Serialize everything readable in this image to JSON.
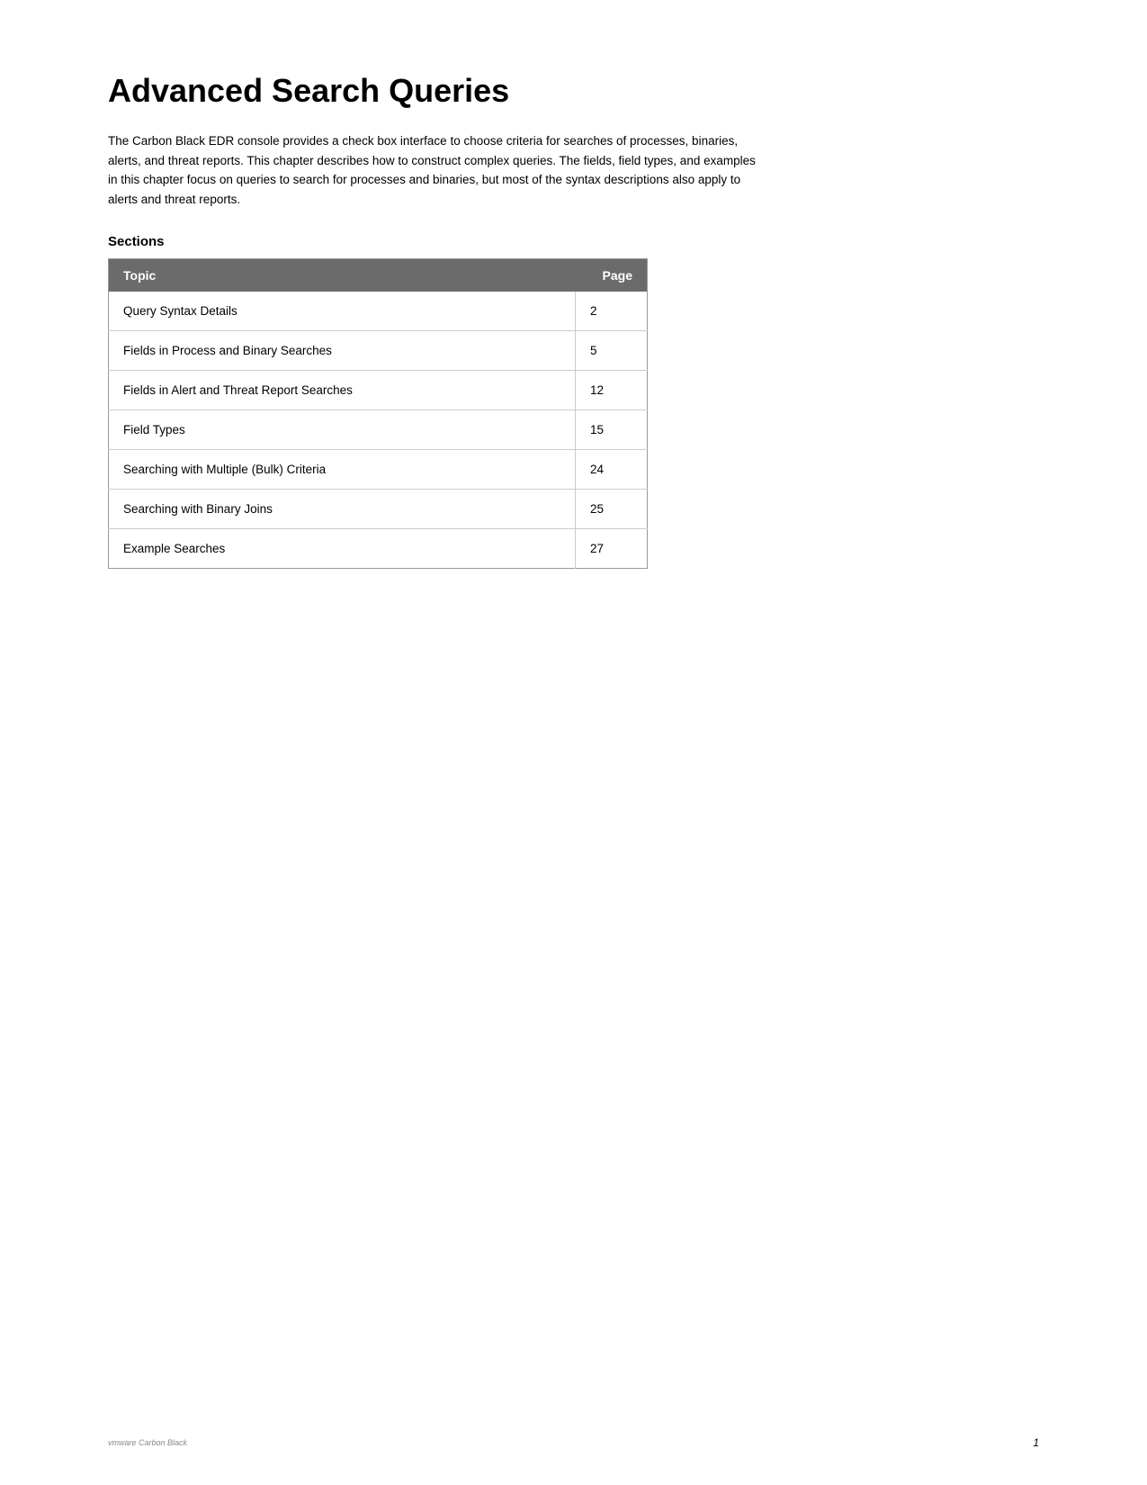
{
  "page": {
    "title": "Advanced Search Queries",
    "intro": "The Carbon Black EDR console provides a check box interface to choose criteria for searches of processes, binaries, alerts, and threat reports. This chapter describes how to construct complex queries. The fields, field types, and examples in this chapter focus on queries to search for processes and binaries, but most of the syntax descriptions also apply to alerts and threat reports.",
    "sections_label": "Sections",
    "table": {
      "headers": {
        "topic": "Topic",
        "page": "Page"
      },
      "rows": [
        {
          "topic": "Query Syntax Details",
          "page": "2"
        },
        {
          "topic": "Fields in Process and Binary Searches",
          "page": "5"
        },
        {
          "topic": "Fields in Alert and Threat Report Searches",
          "page": "12"
        },
        {
          "topic": "Field Types",
          "page": "15"
        },
        {
          "topic": "Searching with Multiple (Bulk) Criteria",
          "page": "24"
        },
        {
          "topic": "Searching with Binary Joins",
          "page": "25"
        },
        {
          "topic": "Example Searches",
          "page": "27"
        }
      ]
    },
    "footer": {
      "logo_text": "vmware Carbon Black",
      "page_number": "1"
    }
  }
}
